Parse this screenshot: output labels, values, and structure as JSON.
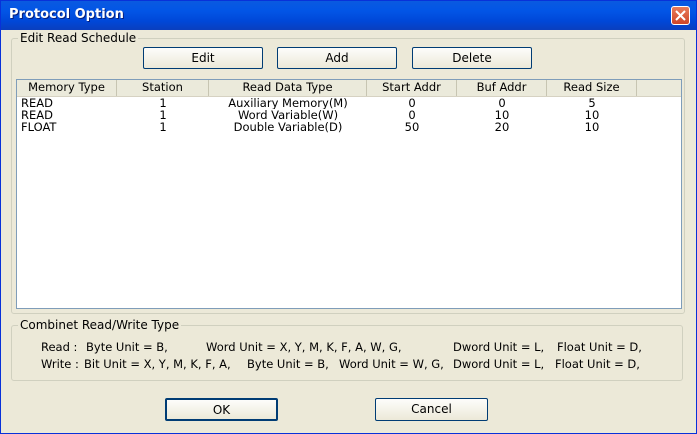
{
  "window": {
    "title": "Protocol Option"
  },
  "schedule": {
    "group_title": "Edit Read Schedule",
    "buttons": {
      "edit": "Edit",
      "add": "Add",
      "delete": "Delete"
    },
    "columns": [
      "Memory Type",
      "Station",
      "Read Data Type",
      "Start Addr",
      "Buf Addr",
      "Read Size"
    ],
    "rows": [
      [
        "READ",
        "1",
        "Auxiliary Memory(M)",
        "0",
        "0",
        "5"
      ],
      [
        "READ",
        "1",
        "Word Variable(W)",
        "0",
        "10",
        "10"
      ],
      [
        "FLOAT",
        "1",
        "Double Variable(D)",
        "50",
        "20",
        "10"
      ]
    ]
  },
  "combined": {
    "group_title": "Combinet Read/Write Type",
    "read_line": {
      "label": "Read :",
      "parts": [
        "Byte Unit = B,",
        "Word Unit = X, Y, M, K, F, A, W, G,",
        "Dword Unit = L,",
        "Float Unit = D,"
      ]
    },
    "write_line": {
      "label": "Write :",
      "parts": [
        "Bit Unit = X, Y, M, K, F, A,",
        "Byte Unit = B,",
        "Word Unit = W, G,",
        "Dword Unit = L,",
        "Float Unit = D,"
      ]
    }
  },
  "footer": {
    "ok": "OK",
    "cancel": "Cancel"
  }
}
